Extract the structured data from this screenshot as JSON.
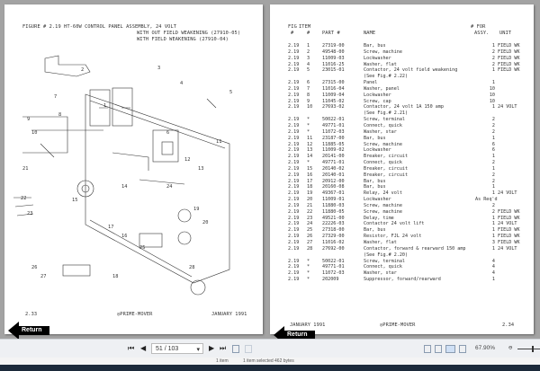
{
  "left_page": {
    "title_line1": "FIGURE # 2.19 HT-60W CONTROL PANEL ASSEMBLY, 24 VOLT",
    "title_line2": "WITH OUT FIELD WEAKENING (27910-05)",
    "title_line3": "WITH FIELD WEAKENING (27910-04)",
    "page_number": "2.33",
    "logo": "PRIME-MOVER",
    "date": "JANUARY 1991",
    "callouts": [
      "1",
      "2",
      "3",
      "4",
      "5",
      "6",
      "7",
      "8",
      "9",
      "10",
      "11",
      "12",
      "13",
      "14",
      "15",
      "16",
      "17",
      "18",
      "19",
      "20",
      "21",
      "22",
      "23",
      "24",
      "25",
      "26",
      "27",
      "28"
    ]
  },
  "right_page": {
    "headers": {
      "fig1": "FIG",
      "fig2": "#",
      "item1": "ITEM",
      "item2": "#",
      "part": "PART #",
      "name": "NAME",
      "qty1": "# FOR",
      "qty2": "ASSY.",
      "unit": "UNIT"
    },
    "rows": [
      [
        "2.19",
        "1",
        "27319-00",
        "Bar, bus",
        "1",
        "FIELD WK"
      ],
      [
        "2.19",
        "2",
        "49548-00",
        "Screw, machine",
        "2",
        "FIELD WK"
      ],
      [
        "2.19",
        "3",
        "11009-03",
        "Lockwasher",
        "2",
        "FIELD WK"
      ],
      [
        "2.19",
        "4",
        "11016-25",
        "Washer, flat",
        "2",
        "FIELD WK"
      ],
      [
        "2.19",
        "5",
        "23015-01",
        "Contactor, 24 volt field weakening",
        "1",
        "FIELD WK"
      ],
      [
        "",
        "",
        "",
        "(See Fig.# 2.22)",
        "",
        ""
      ],
      [
        "2.19",
        "6",
        "27315-00",
        "Panel",
        "1",
        ""
      ],
      [
        "2.19",
        "7",
        "11016-04",
        "Washer, panel",
        "10",
        ""
      ],
      [
        "2.19",
        "8",
        "11009-04",
        "Lockwasher",
        "10",
        ""
      ],
      [
        "2.19",
        "9",
        "11045-02",
        "Screw, cap",
        "10",
        ""
      ],
      [
        "2.19",
        "10",
        "27693-02",
        "Contactor, 24 volt 1A 150 amp",
        "1",
        "24 VOLT"
      ],
      [
        "",
        "",
        "",
        "(See Fig.# 2.21)",
        "",
        ""
      ],
      [
        "2.19",
        "*",
        "50022-01",
        "Screw, terminal",
        "2",
        ""
      ],
      [
        "2.19",
        "*",
        "49771-01",
        "Connect, quick",
        "2",
        ""
      ],
      [
        "2.19",
        "*",
        "11072-03",
        "Washer, star",
        "2",
        ""
      ],
      [
        "2.19",
        "11",
        "23187-00",
        "Bar, bus",
        "1",
        ""
      ],
      [
        "2.19",
        "12",
        "11885-05",
        "Screw, machine",
        "6",
        ""
      ],
      [
        "2.19",
        "13",
        "11009-02",
        "Lockwasher",
        "6",
        ""
      ],
      [
        "2.19",
        "14",
        "20141-00",
        "Breaker, circuit",
        "1",
        ""
      ],
      [
        "2.19",
        "*",
        "49771-01",
        "Connect, quick",
        "2",
        ""
      ],
      [
        "2.19",
        "15",
        "20140-02",
        "Breaker, circuit",
        "1",
        ""
      ],
      [
        "2.19",
        "16",
        "20140-01",
        "Breaker, circuit",
        "2",
        ""
      ],
      [
        "2.19",
        "17",
        "20912-00",
        "Bar, bus",
        "2",
        ""
      ],
      [
        "2.19",
        "18",
        "20160-08",
        "Bar, bus",
        "1",
        ""
      ],
      [
        "2.19",
        "19",
        "49367-01",
        "Relay, 24 volt",
        "1",
        "24 VOLT"
      ],
      [
        "2.19",
        "20",
        "11009-01",
        "Lockwasher",
        "As Req'd",
        ""
      ],
      [
        "2.19",
        "21",
        "11880-03",
        "Screw, machine",
        "2",
        ""
      ],
      [
        "2.19",
        "22",
        "11880-05",
        "Screw, machine",
        "2",
        "FIELD WK"
      ],
      [
        "2.19",
        "23",
        "49521-00",
        "Delay, time",
        "1",
        "FIELD WK"
      ],
      [
        "2.19",
        "24",
        "22226-03",
        "Contactor 24 volt lift",
        "1",
        "24 VOLT"
      ],
      [
        "2.19",
        "25",
        "27318-00",
        "Bar, bus",
        "1",
        "FIELD WK"
      ],
      [
        "2.19",
        "26",
        "27329-00",
        "Resistor, FJL 24 volt",
        "1",
        "FIELD WK"
      ],
      [
        "2.19",
        "27",
        "11016-02",
        "Washer, flat",
        "3",
        "FIELD WK"
      ],
      [
        "2.19",
        "28",
        "27692-00",
        "Contactor, forward & rearward 150 amp",
        "1",
        "24 VOLT"
      ],
      [
        "",
        "",
        "",
        "(See Fig.# 2.20)",
        "",
        ""
      ],
      [
        "2.19",
        "*",
        "50022-01",
        "Screw, terminal",
        "4",
        ""
      ],
      [
        "2.19",
        "*",
        "49771-01",
        "Connect, quick",
        "4",
        ""
      ],
      [
        "2.19",
        "*",
        "11072-03",
        "Washer, star",
        "4",
        ""
      ],
      [
        "2.19",
        "*",
        "202009",
        "Suppressor, forward/rearward",
        "1",
        ""
      ]
    ],
    "date": "JANUARY 1991",
    "logo": "PRIME-MOVER",
    "page_number": "2.34"
  },
  "return_label": "Return",
  "toolbar": {
    "page_field": "51 / 103",
    "zoom": "67.90%"
  },
  "status": {
    "items": "1 item",
    "selected": "1 item selected  462 bytes"
  }
}
